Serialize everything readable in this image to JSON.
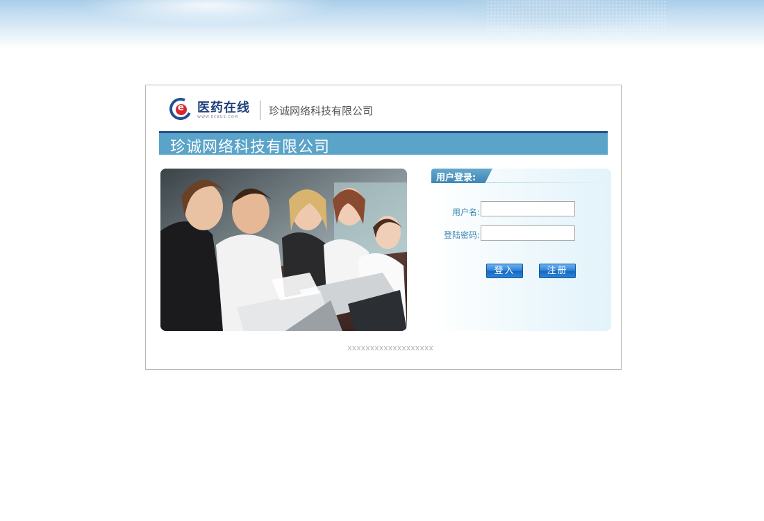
{
  "header": {
    "logo_name": "医药在线",
    "logo_url": "WWW.ECBUS.COM",
    "company_name": "珍诚网络科技有限公司"
  },
  "title_bar": {
    "title": "珍诚网络科技有限公司"
  },
  "login": {
    "panel_title": "用户登录:",
    "username_label": "用户名:",
    "username_value": "",
    "password_label": "登陆密码:",
    "password_value": "",
    "login_button": "登入",
    "register_button": "注册"
  },
  "footer": {
    "text": "xxxxxxxxxxxxxxxxxxx"
  },
  "colors": {
    "title_bar": "#5aa3c9",
    "title_bar_border": "#244f86",
    "label_text": "#3a86b2",
    "button": "#2c82d8"
  }
}
